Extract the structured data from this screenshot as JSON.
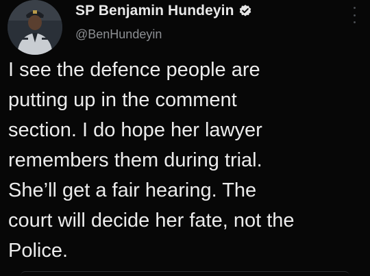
{
  "tweet": {
    "author": {
      "display_name": "SP Benjamin Hundeyin",
      "handle": "@BenHundeyin",
      "verified": true
    },
    "text": "I see the defence people are\nputting up in the comment\nsection. I do hope her lawyer\nremembers them during trial.\nShe’ll get a fair hearing. The\ncourt will decide her fate, not the\nPolice."
  },
  "icons": {
    "avatar": "profile-photo",
    "verified": "verified-badge-icon",
    "more": "more-options-icon"
  },
  "colors": {
    "background": "#070707",
    "text": "#ececec",
    "handle": "#8c8f93",
    "verified_badge": "#e6e6e6"
  }
}
